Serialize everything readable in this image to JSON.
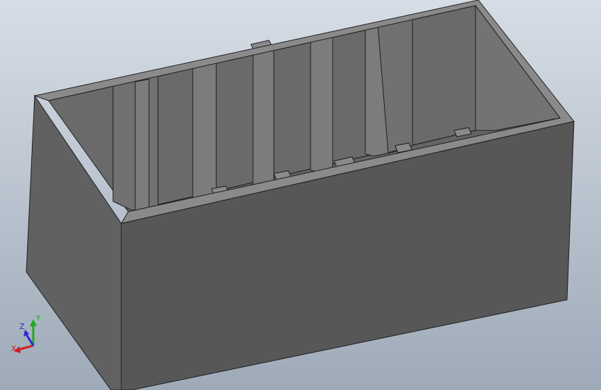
{
  "viewport": {
    "background_top": "#d6dde6",
    "background_bottom": "#9eaab8"
  },
  "model": {
    "face_front": "#575757",
    "face_left": "#616161",
    "face_rim": "#8a8a8a",
    "inner_back": "#6a6a6a",
    "inner_right": "#737373",
    "floor": "#656565",
    "rib": "#7c7c7c",
    "edge": "#1c1c1c"
  },
  "triad": {
    "x_label": "X",
    "y_label": "Y",
    "z_label": "Z",
    "x_color": "#cc1f1f",
    "y_color": "#1fa81f",
    "z_color": "#2a2ad0"
  }
}
